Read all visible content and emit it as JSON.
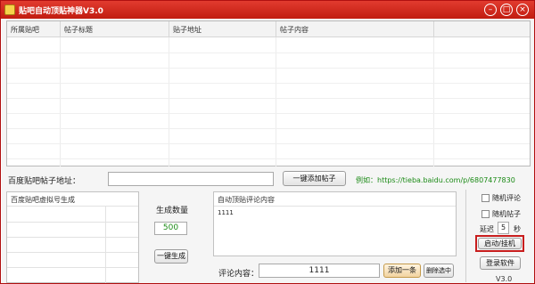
{
  "window": {
    "title": "贴吧自动顶贴神器V3.0",
    "minimize_icon": "minimize-icon",
    "maximize_icon": "maximize-icon",
    "close_icon": "close-icon",
    "accent": "#c81d1d"
  },
  "grid": {
    "columns": [
      "所属贴吧",
      "帖子标题",
      "贴子地址",
      "帖子内容"
    ]
  },
  "url_row": {
    "label": "百度贴吧帖子地址：",
    "value": "",
    "add_button": "一键添加帖子",
    "example": "例如：https://tieba.baidu.com/p/6807477830"
  },
  "virtual_accounts": {
    "title": "百度贴吧虚拟号生成"
  },
  "generate": {
    "label": "生成数量",
    "count": "500",
    "button": "一键生成"
  },
  "comments": {
    "title": "自动顶贴评论内容",
    "items": [
      "1111"
    ],
    "input_label": "评论内容：",
    "input_value": "1111",
    "add_button": "添加一条",
    "delete_button": "删除选中"
  },
  "options": {
    "random_comment": "随机评论",
    "random_post": "随机帖子",
    "delay_label": "延迟",
    "delay_value": "5",
    "delay_unit": "秒",
    "start_button": "启动/挂机",
    "login_button": "登录软件",
    "version": "V3.0"
  }
}
